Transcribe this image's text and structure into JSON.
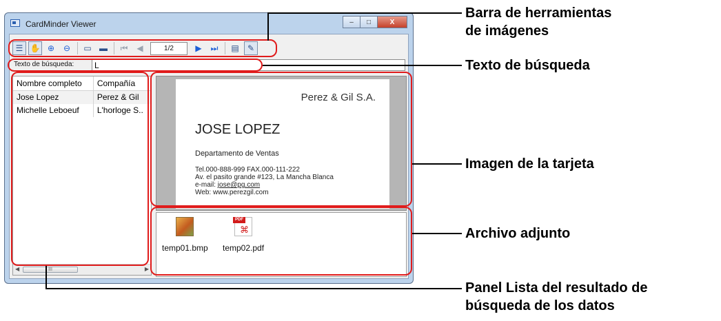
{
  "window": {
    "title": "CardMinder Viewer",
    "controls": {
      "minimize": "–",
      "maximize": "□",
      "close": "X"
    }
  },
  "toolbar": {
    "page_indicator": "1/2",
    "icons": [
      "list-view-icon",
      "hand-icon",
      "zoom-in-icon",
      "zoom-out-icon",
      "card-view-icon",
      "fit-icon",
      "first-page-icon",
      "prev-page-icon",
      "next-page-icon",
      "last-page-icon",
      "form-icon",
      "edit-icon"
    ]
  },
  "search": {
    "label": "Texto de búsqueda:",
    "value": "L"
  },
  "list": {
    "columns": [
      "Nombre completo",
      "Compañía"
    ],
    "rows": [
      [
        "Jose Lopez",
        "Perez & Gil"
      ],
      [
        "Michelle Leboeuf",
        "L'horloge S.."
      ]
    ],
    "scroll_label": "III"
  },
  "card": {
    "company": "Perez & Gil S.A.",
    "name": "JOSE LOPEZ",
    "department": "Departamento de Ventas",
    "phone": "Tel.000-888-999   FAX.000-111-222",
    "address": "Av. el pasito grande #123, La Mancha Blanca",
    "email_label": "e-mail: ",
    "email": "jose@pg.com",
    "web": "Web: www.perezgil.com"
  },
  "attachments": [
    {
      "name": "temp01.bmp",
      "icon": "bitmap-file-icon"
    },
    {
      "name": "temp02.pdf",
      "icon": "pdf-file-icon",
      "tag": "PDF"
    }
  ],
  "callouts": {
    "toolbar_line1": "Barra de herramientas",
    "toolbar_line2": "de imágenes",
    "search": "Texto de búsqueda",
    "card_image": "Imagen de la tarjeta",
    "attachment": "Archivo adjunto",
    "list_line1": "Panel Lista del resultado de",
    "list_line2": "búsqueda de los datos"
  },
  "colors": {
    "highlight": "#e01b1b",
    "window_frame": "#bcd3ec",
    "card_background": "#b5b5b5"
  }
}
